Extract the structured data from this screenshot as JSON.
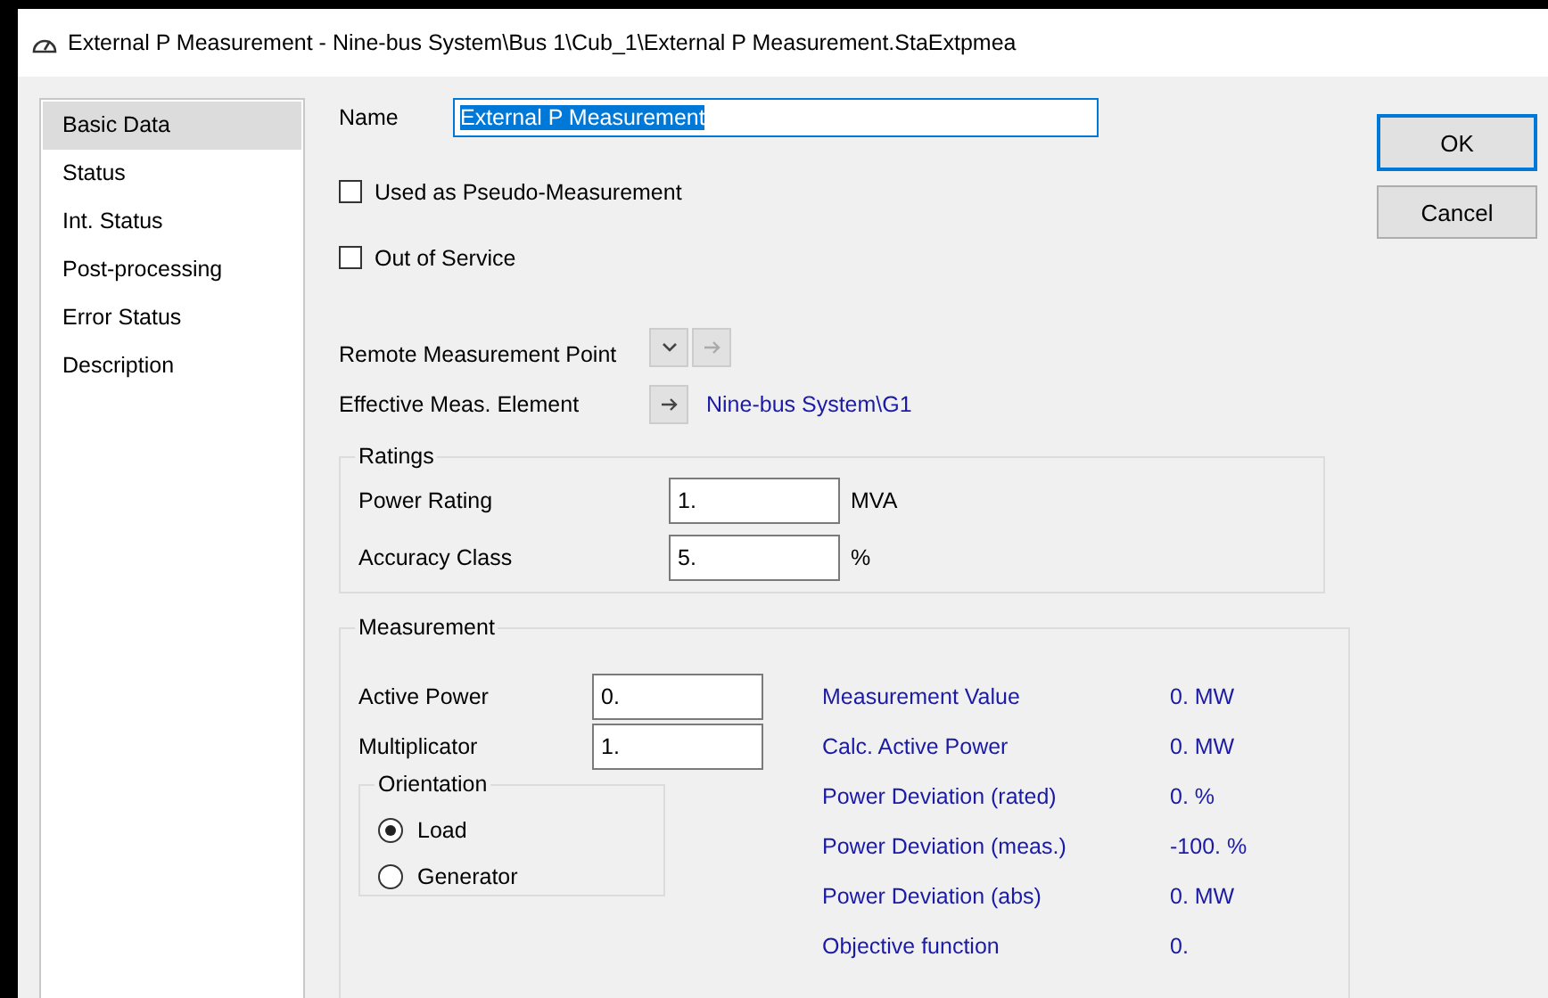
{
  "window": {
    "title": "External P Measurement - Nine-bus System\\Bus 1\\Cub_1\\External P Measurement.StaExtpmea"
  },
  "sidebar": {
    "items": [
      {
        "label": "Basic Data",
        "selected": true
      },
      {
        "label": "Status",
        "selected": false
      },
      {
        "label": "Int. Status",
        "selected": false
      },
      {
        "label": "Post-processing",
        "selected": false
      },
      {
        "label": "Error Status",
        "selected": false
      },
      {
        "label": "Description",
        "selected": false
      }
    ]
  },
  "name": {
    "label": "Name",
    "value": "External P Measurement",
    "text_selected": true
  },
  "checkboxes": [
    {
      "label": "Used as Pseudo-Measurement",
      "checked": false
    },
    {
      "label": "Out of Service",
      "checked": false
    }
  ],
  "remote_point": {
    "label": "Remote Measurement Point"
  },
  "effective_element": {
    "label": "Effective Meas. Element",
    "value": "Nine-bus System\\G1"
  },
  "ratings": {
    "title": "Ratings",
    "rows": [
      {
        "label": "Power Rating",
        "value": "1.",
        "unit": "MVA"
      },
      {
        "label": "Accuracy Class",
        "value": "5.",
        "unit": "%"
      }
    ]
  },
  "measurement": {
    "title": "Measurement",
    "inputs": [
      {
        "label": "Active Power",
        "value": "0."
      },
      {
        "label": "Multiplicator",
        "value": "1."
      }
    ],
    "orientation": {
      "title": "Orientation",
      "options": [
        {
          "label": "Load",
          "selected": true
        },
        {
          "label": "Generator",
          "selected": false
        }
      ]
    },
    "results": [
      {
        "label": "Measurement Value",
        "value": "0. MW"
      },
      {
        "label": "Calc. Active Power",
        "value": "0. MW"
      },
      {
        "label": "Power Deviation (rated)",
        "value": "0. %"
      },
      {
        "label": "Power Deviation (meas.)",
        "value": "-100. %"
      },
      {
        "label": "Power Deviation (abs)",
        "value": "0. MW"
      },
      {
        "label": "Objective function",
        "value": "0."
      }
    ]
  },
  "buttons": [
    {
      "label": "OK",
      "default": true
    },
    {
      "label": "Cancel",
      "default": false
    }
  ]
}
